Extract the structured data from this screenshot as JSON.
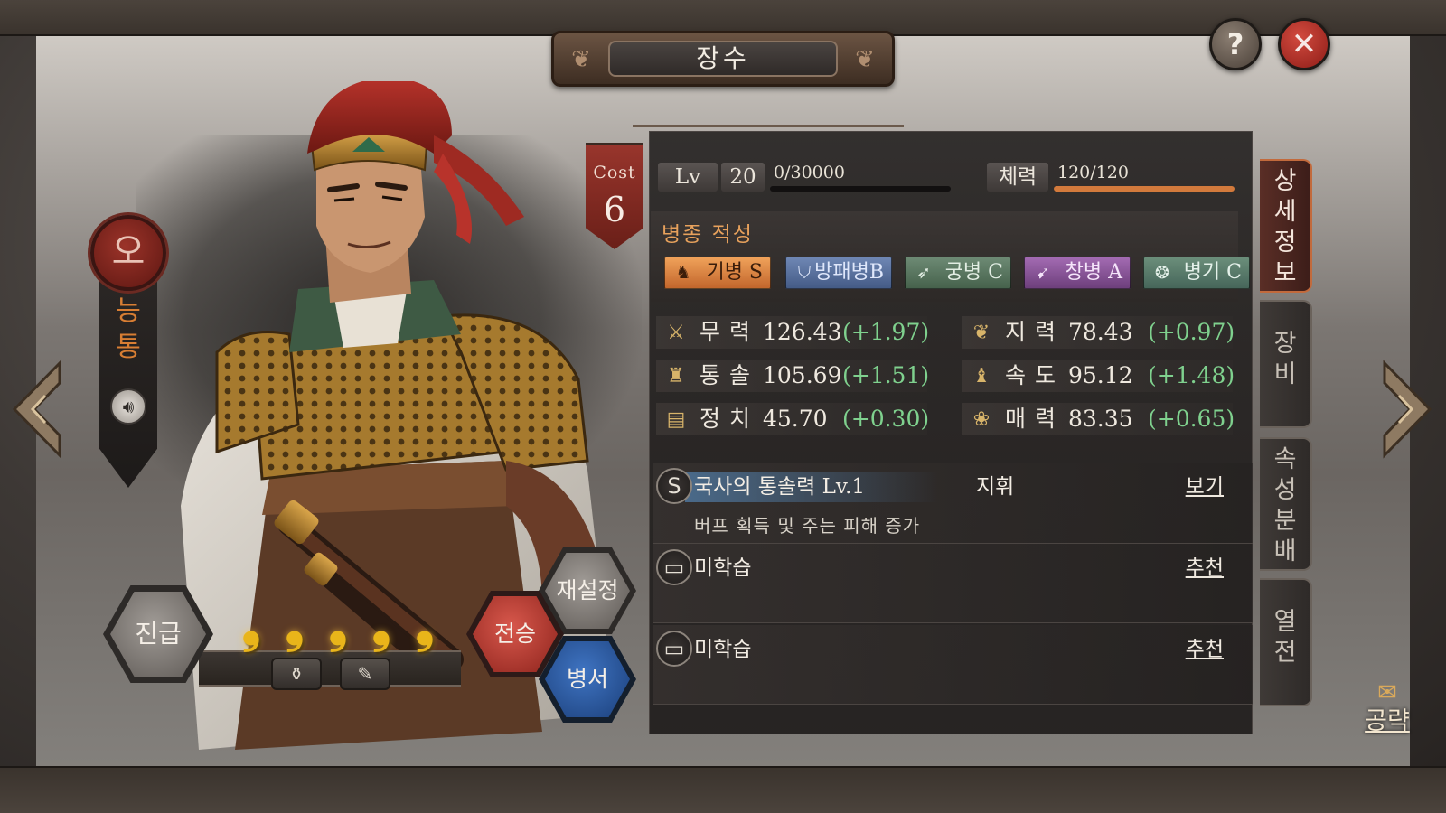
{
  "header": {
    "title": "장수",
    "help_label": "?",
    "close_label": "✕"
  },
  "general": {
    "faction": "오",
    "name_chars": [
      "능",
      "통"
    ],
    "voice_icon": "speaker-icon",
    "cost_label": "Cost",
    "cost_value": "6"
  },
  "bottom_controls": {
    "advance_label": "진급",
    "reset_label": "재설정",
    "inherit_label": "전승",
    "book_label": "병서",
    "star_glyph": "❟",
    "stars_count": 5,
    "items": [
      "⚱",
      "✎"
    ]
  },
  "level": {
    "lv_label": "Lv",
    "lv_value": "20",
    "exp_text": "0/30000",
    "exp_fraction": 0.0,
    "hp_label": "체력",
    "hp_text": "120/120",
    "hp_fraction": 1.0
  },
  "affinity": {
    "title": "병종 적성",
    "items": [
      {
        "icon": "horse-icon",
        "glyph": "♞",
        "label": "기병 S"
      },
      {
        "icon": "shield-icon",
        "glyph": "⛉",
        "label": "방패병B"
      },
      {
        "icon": "bow-icon",
        "glyph": "➶",
        "label": "궁병 C"
      },
      {
        "icon": "spear-icon",
        "glyph": "➹",
        "label": "창병 A"
      },
      {
        "icon": "wheel-icon",
        "glyph": "❂",
        "label": "병기 C"
      }
    ]
  },
  "stats": [
    {
      "icon": "swords-icon",
      "glyph": "⚔",
      "name": "무력",
      "value": "126.43",
      "bonus": "(+1.97)"
    },
    {
      "icon": "brain-icon",
      "glyph": "❦",
      "name": "지력",
      "value": "78.43",
      "bonus": "(+0.97)"
    },
    {
      "icon": "command-icon",
      "glyph": "♜",
      "name": "통솔",
      "value": "105.69",
      "bonus": "(+1.51)"
    },
    {
      "icon": "boot-icon",
      "glyph": "♝",
      "name": "속도",
      "value": "95.12",
      "bonus": "(+1.48)"
    },
    {
      "icon": "scroll-icon",
      "glyph": "▤",
      "name": "정치",
      "value": "45.70",
      "bonus": "(+0.30)"
    },
    {
      "icon": "charm-icon",
      "glyph": "❀",
      "name": "매력",
      "value": "83.35",
      "bonus": "(+0.65)"
    }
  ],
  "skills": {
    "main": {
      "grade": "S",
      "name": "국사의 통솔력 Lv.1",
      "type": "지휘",
      "link": "보기",
      "desc": "버프 획득 및 주는 피해 증가"
    },
    "slot1": {
      "name": "미학습",
      "link": "추천",
      "icon": "book-slot-icon"
    },
    "slot2": {
      "name": "미학습",
      "link": "추천",
      "icon": "book-slot-icon"
    }
  },
  "tabs": [
    {
      "label": "상세정보",
      "active": true
    },
    {
      "label": "장비",
      "active": false
    },
    {
      "label": "속성분배",
      "active": false
    },
    {
      "label": "열전",
      "active": false
    }
  ],
  "guide": {
    "label": "공략",
    "icon": "scroll-icon"
  },
  "colors": {
    "accent_orange": "#e7a15c",
    "bonus_green": "#7fd18e",
    "faction_red": "#9b3329"
  }
}
